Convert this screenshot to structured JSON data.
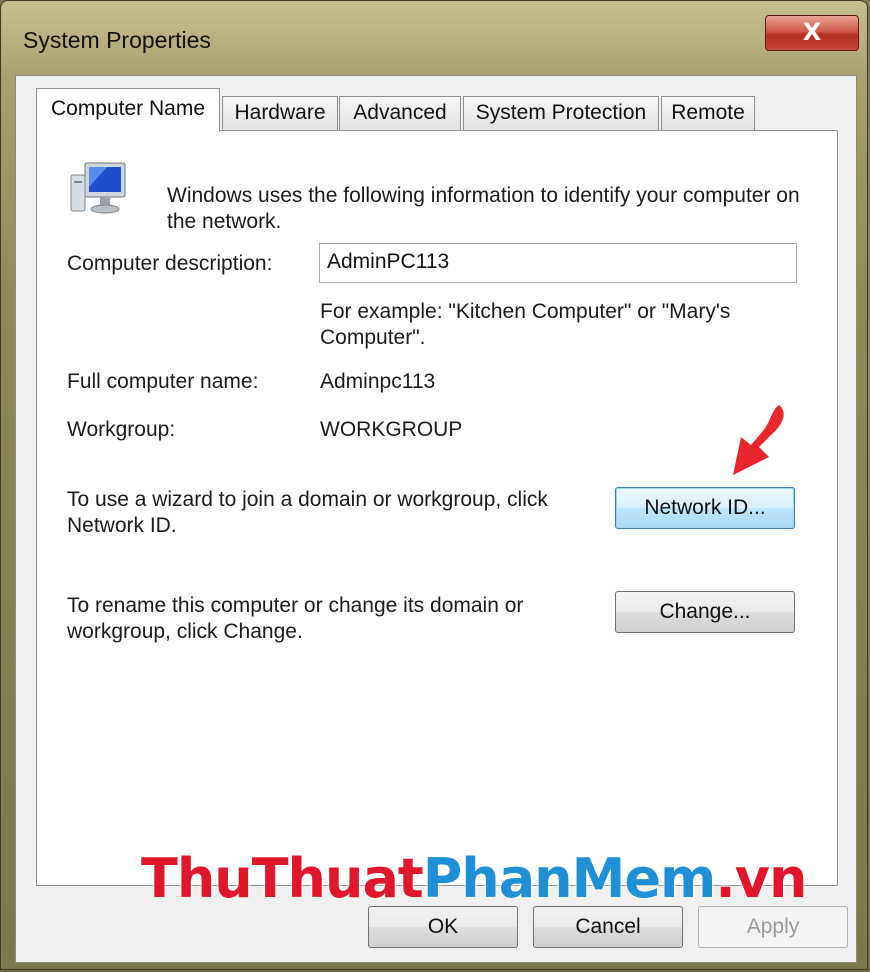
{
  "window": {
    "title": "System Properties",
    "close_label": "X"
  },
  "tabs": [
    {
      "label": "Computer Name",
      "active": true
    },
    {
      "label": "Hardware",
      "active": false
    },
    {
      "label": "Advanced",
      "active": false
    },
    {
      "label": "System Protection",
      "active": false
    },
    {
      "label": "Remote",
      "active": false
    }
  ],
  "panel": {
    "intro": "Windows uses the following information to identify your computer on the network.",
    "description_label": "Computer description:",
    "description_value": "AdminPC113",
    "description_example": "For example: \"Kitchen Computer\" or \"Mary's Computer\".",
    "full_name_label": "Full computer name:",
    "full_name_value": "Adminpc113",
    "workgroup_label": "Workgroup:",
    "workgroup_value": "WORKGROUP",
    "network_text": "To use a wizard to join a domain or workgroup, click Network ID.",
    "network_button": "Network ID...",
    "rename_text": "To rename this computer or change its domain or workgroup, click Change.",
    "change_button": "Change..."
  },
  "footer": {
    "ok": "OK",
    "cancel": "Cancel",
    "apply": "Apply"
  },
  "watermark": {
    "part1": "ThuThuat",
    "part2": "PhanMem",
    "part3": ".vn"
  },
  "colors": {
    "arrow": "#e8262c",
    "focus_border": "#3c7fb1",
    "close": "#c9463a"
  },
  "icons": {
    "computer": "computer-icon",
    "annotation": "red-arrow-icon"
  }
}
